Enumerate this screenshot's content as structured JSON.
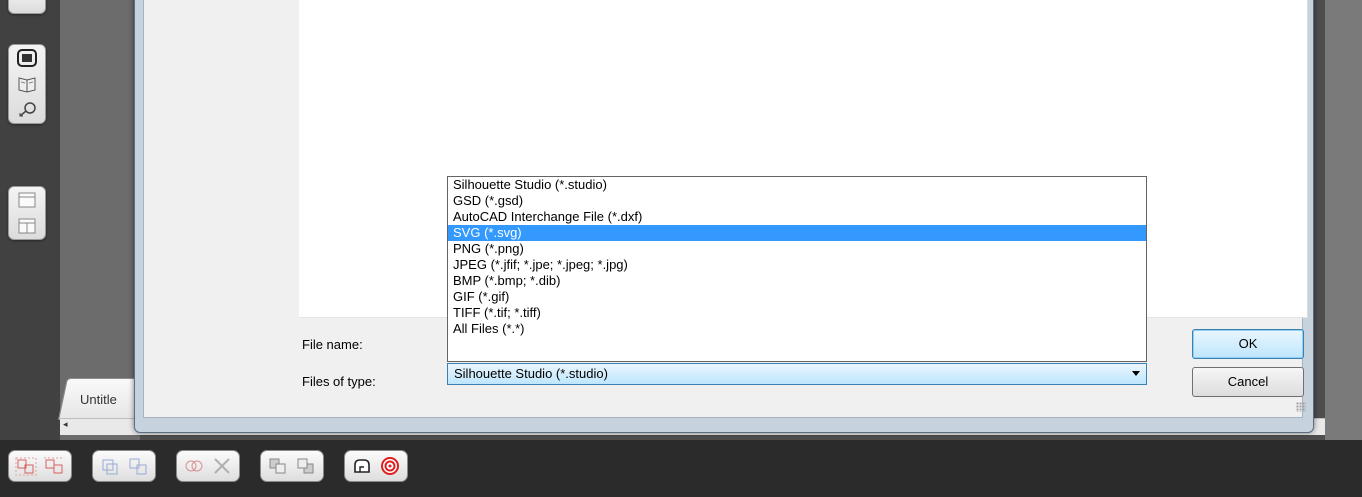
{
  "document": {
    "tab_label": "Untitle",
    "scroll_left_arrow": "◂"
  },
  "dialog": {
    "filename_label": "File name:",
    "filetype_label": "Files of type:",
    "filetype_selected": "Silhouette Studio (*.studio)",
    "filetype_options": [
      "Silhouette Studio (*.studio)",
      "GSD (*.gsd)",
      "AutoCAD Interchange File (*.dxf)",
      "SVG (*.svg)",
      "PNG (*.png)",
      "JPEG (*.jfif; *.jpe; *.jpeg; *.jpg)",
      "BMP (*.bmp; *.dib)",
      "GIF (*.gif)",
      "TIFF (*.tif; *.tiff)",
      "All Files (*.*)"
    ],
    "highlighted_option": "SVG (*.svg)",
    "ok_label": "OK",
    "cancel_label": "Cancel"
  },
  "left_toolbar_icons": [
    "page-view-icon",
    "book-icon",
    "tag-icon",
    "single-panel-icon",
    "split-panel-icon"
  ],
  "bottom_toolbar_icons": [
    "group-icon",
    "ungroup-icon",
    "compound-path-icon",
    "release-compound-icon",
    "weld-icon",
    "delete-icon",
    "bring-forward-icon",
    "send-backward-icon",
    "offset-icon",
    "target-icon"
  ],
  "colors": {
    "selection": "#3399ff",
    "accent_button": "#3c7fb1",
    "target_red": "#e02020"
  }
}
